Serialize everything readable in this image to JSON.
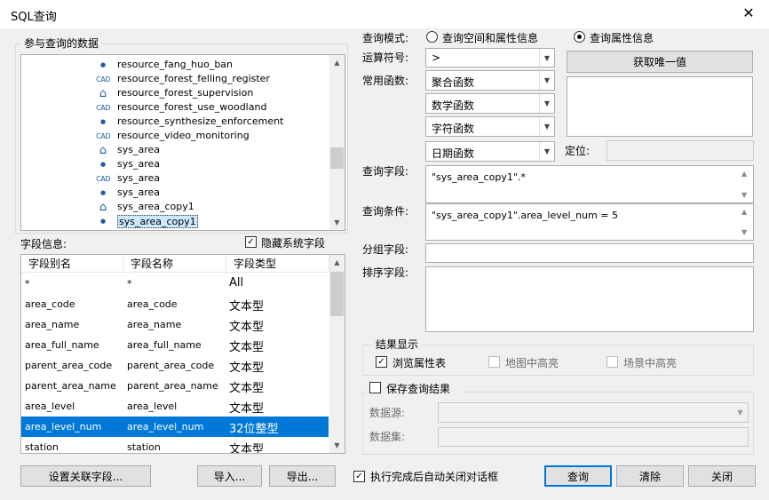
{
  "window": {
    "title": "SQL查询",
    "close_glyph": "✕"
  },
  "left_group": {
    "label": "参与查询的数据"
  },
  "tree": {
    "items": [
      {
        "label": "resource_fang_huo_ban",
        "icon": "point-layer-icon"
      },
      {
        "label": "resource_forest_felling_register",
        "icon": "cad-layer-icon"
      },
      {
        "label": "resource_forest_supervision",
        "icon": "region-layer-icon"
      },
      {
        "label": "resource_forest_use_woodland",
        "icon": "cad-layer-icon"
      },
      {
        "label": "resource_synthesize_enforcement",
        "icon": "point-layer-icon"
      },
      {
        "label": "resource_video_monitoring",
        "icon": "cad-layer-icon"
      },
      {
        "label": "sys_area",
        "icon": "region-layer-icon"
      },
      {
        "label": "sys_area",
        "icon": "point-layer-icon"
      },
      {
        "label": "sys_area",
        "icon": "cad-layer-icon"
      },
      {
        "label": "sys_area",
        "icon": "point-layer-icon"
      },
      {
        "label": "sys_area_copy1",
        "icon": "region-layer-icon"
      },
      {
        "label": "sys_area_copy1",
        "icon": "point-layer-icon",
        "selected": true
      }
    ]
  },
  "fields": {
    "label": "字段信息:",
    "hide_system_label": "隐藏系统字段",
    "hide_system_checked": true,
    "columns": [
      "字段别名",
      "字段名称",
      "字段类型"
    ],
    "rows": [
      {
        "alias": "*",
        "name": "*",
        "type": "All"
      },
      {
        "alias": "area_code",
        "name": "area_code",
        "type": "文本型"
      },
      {
        "alias": "area_name",
        "name": "area_name",
        "type": "文本型"
      },
      {
        "alias": "area_full_name",
        "name": "area_full_name",
        "type": "文本型"
      },
      {
        "alias": "parent_area_code",
        "name": "parent_area_code",
        "type": "文本型"
      },
      {
        "alias": "parent_area_name",
        "name": "parent_area_name",
        "type": "文本型"
      },
      {
        "alias": "area_level",
        "name": "area_level",
        "type": "文本型"
      },
      {
        "alias": "area_level_num",
        "name": "area_level_num",
        "type": "32位整型",
        "selected": true
      },
      {
        "alias": "station",
        "name": "station",
        "type": "文本型"
      }
    ]
  },
  "query_mode": {
    "label": "查询模式:",
    "options": [
      {
        "label": "查询空间和属性信息",
        "selected": false
      },
      {
        "label": "查询属性信息",
        "selected": true
      }
    ]
  },
  "operator": {
    "label": "运算符号:",
    "value": ">"
  },
  "unique_button": "获取唯一值",
  "functions": {
    "label": "常用函数:",
    "items": [
      "聚合函数",
      "数学函数",
      "字符函数",
      "日期函数"
    ]
  },
  "locate": {
    "label": "定位:",
    "value": ""
  },
  "query_field": {
    "label": "查询字段:",
    "value": "\"sys_area_copy1\".*"
  },
  "query_condition": {
    "label": "查询条件:",
    "value": "\"sys_area_copy1\".area_level_num = 5"
  },
  "group_field": {
    "label": "分组字段:",
    "value": ""
  },
  "sort_field": {
    "label": "排序字段:",
    "value": ""
  },
  "result_display": {
    "label": "结果显示",
    "options": [
      {
        "label": "浏览属性表",
        "checked": true,
        "enabled": true
      },
      {
        "label": "地图中高亮",
        "checked": false,
        "enabled": false
      },
      {
        "label": "场景中高亮",
        "checked": false,
        "enabled": false
      }
    ]
  },
  "save_result": {
    "label": "保存查询结果",
    "checked": false,
    "datasource_label": "数据源:",
    "dataset_label": "数据集:"
  },
  "bottom": {
    "set_relation": "设置关联字段...",
    "import": "导入...",
    "export": "导出...",
    "auto_close_label": "执行完成后自动关闭对话框",
    "auto_close_checked": true,
    "query": "查询",
    "clear": "清除",
    "close": "关闭"
  },
  "colors": {
    "selection": "#0078d7",
    "tree_selection": "#cce8ff",
    "icon": "#1e5aa8"
  }
}
